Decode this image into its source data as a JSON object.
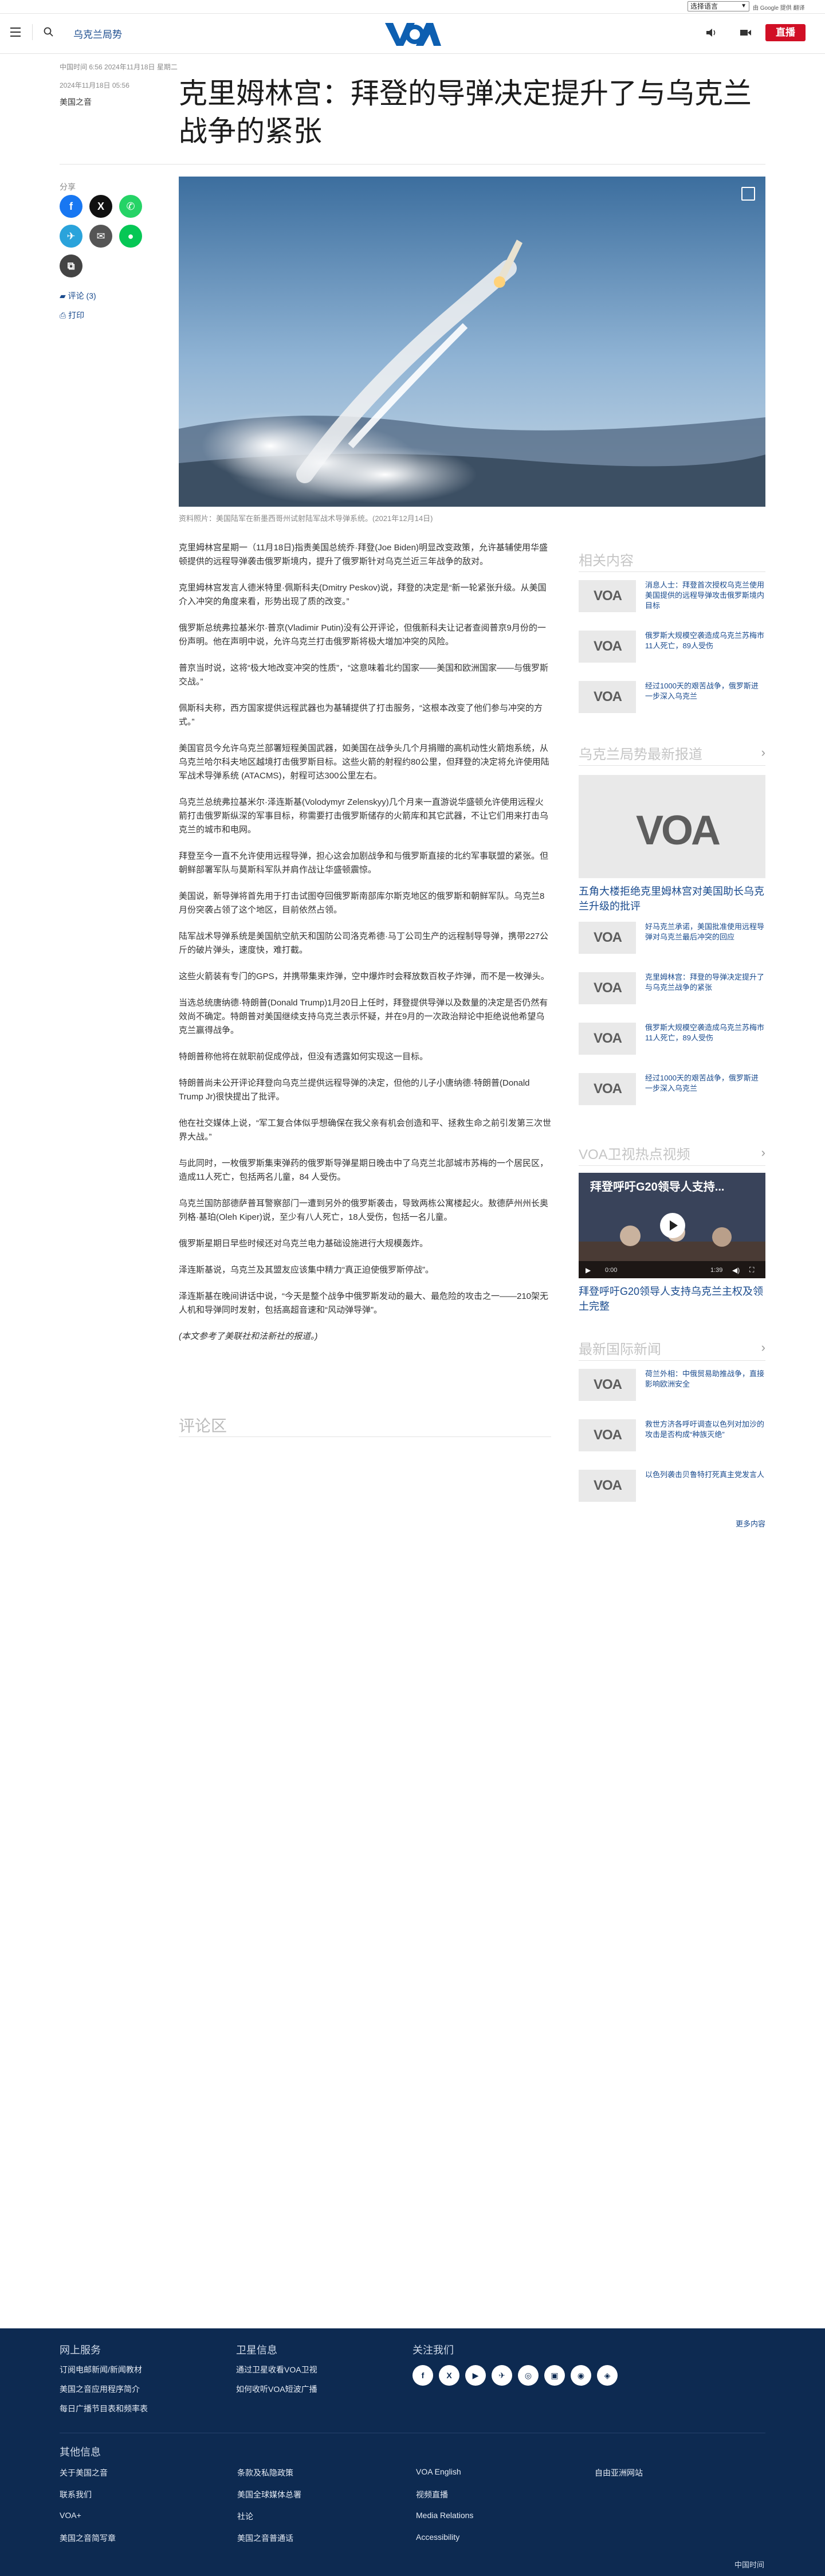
{
  "translate": {
    "select_label": "选择语言",
    "powered": "由 Google 提供 翻译"
  },
  "header": {
    "section_link": "乌克兰局势",
    "logo": "VOA",
    "live_label": "直播"
  },
  "article": {
    "meta_date": "中国时间 6:56 2024年11月18日 星期二",
    "meta_date2": "2024年11月18日 05:56",
    "author": "美国之音",
    "title": "克里姆林宫：拜登的导弹决定提升了与乌克兰战争的紧张",
    "share_label": "分享",
    "comments_link": "评论 (3)",
    "print_link": "打印",
    "caption": "资料照片：美国陆军在新墨西哥州试射陆军战术导弹系统。(2021年12月14日)",
    "paragraphs": [
      "克里姆林宫星期一（11月18日)指责美国总统乔·拜登(Joe Biden)明显改变政策，允许基辅使用华盛顿提供的远程导弹袭击俄罗斯境内，提升了俄罗斯针对乌克兰近三年战争的敌对。",
      "克里姆林宫发言人德米特里·佩斯科夫(Dmitry Peskov)说，拜登的决定是“新一轮紧张升级。从美国介入冲突的角度来看，形势出现了质的改变。”",
      "俄罗斯总统弗拉基米尔·普京(Vladimir Putin)没有公开评论，但俄新科夫让记者查阅普京9月份的一份声明。他在声明中说，允许乌克兰打击俄罗斯将极大增加冲突的风险。",
      "普京当时说，这将“极大地改变冲突的性质”，“这意味着北约国家——美国和欧洲国家——与俄罗斯交战。”",
      "佩斯科夫称，西方国家提供远程武器也为基辅提供了打击服务，“这根本改变了他们参与冲突的方式。”",
      "美国官员今允许乌克兰部署短程美国武器，如美国在战争头几个月捐赠的高机动性火箭炮系统，从乌克兰哈尔科夫地区越境打击俄罗斯目标。这些火箭的射程约80公里，但拜登的决定将允许使用陆军战术导弹系统 (ATACMS)，射程可达300公里左右。",
      "乌克兰总统弗拉基米尔·泽连斯基(Volodymyr Zelenskyy)几个月来一直游说华盛顿允许使用远程火箭打击俄罗斯纵深的军事目标，称需要打击俄罗斯储存的火箭库和其它武器，不让它们用来打击乌克兰的城市和电网。",
      "拜登至今一直不允许使用远程导弹，担心这会加剧战争和与俄罗斯直接的北约军事联盟的紧张。但朝鲜部署军队与莫斯科军队并肩作战让华盛顿震惊。",
      "美国说，新导弹将首先用于打击试图夺回俄罗斯南部库尔斯克地区的俄罗斯和朝鲜军队。乌克兰8月份突袭占领了这个地区，目前依然占领。",
      "陆军战术导弹系统是美国航空航天和国防公司洛克希德·马丁公司生产的远程制导导弹，携带227公斤的破片弹头，速度快，难打截。",
      "这些火箭装有专门的GPS，并携带集束炸弹，空中爆炸时会释放数百枚子炸弹，而不是一枚弹头。",
      "当选总统唐纳德·特朗普(Donald Trump)1月20日上任时，拜登提供导弹以及数量的决定是否仍然有效尚不确定。特朗普对美国继续支持乌克兰表示怀疑，并在9月的一次政治辩论中拒绝说他希望乌克兰赢得战争。",
      "特朗普称他将在就职前促成停战，但没有透露如何实现这一目标。",
      "特朗普尚未公开评论拜登向乌克兰提供远程导弹的决定，但他的儿子小唐纳德·特朗普(Donald Trump Jr)很快提出了批评。",
      "他在社交媒体上说，“军工复合体似乎想确保在我父亲有机会创造和平、拯救生命之前引发第三次世界大战。”",
      "与此同时，一枚俄罗斯集束弹药的俄罗斯导弹星期日晚击中了乌克兰北部城市苏梅的一个居民区，造成11人死亡，包括两名儿童，84 人受伤。",
      "乌克兰国防部德萨普耳警察部门一遭到另外的俄罗斯袭击，导致两栋公寓楼起火。敖德萨州州长奥列格·基珀(Oleh Kiper)说，至少有八人死亡，18人受伤，包括一名儿童。",
      "俄罗斯星期日早些时候还对乌克兰电力基础设施进行大规模轰炸。",
      "泽连斯基说，乌克兰及其盟友应该集中精力“真正迫使俄罗斯停战”。",
      "泽连斯基在晚间讲话中说，“今天是整个战争中俄罗斯发动的最大、最危险的攻击之一——210架无人机和导弹同时发射，包括高超音速和“风动弹导弹”。",
      "(本文参考了美联社和法新社的报道。)"
    ],
    "comments_heading": "评论区"
  },
  "sidebar": {
    "related_heading": "相关内容",
    "related": [
      "消息人士：拜登首次授权乌克兰使用美国提供的远程导弹攻击俄罗斯境内目标",
      "俄罗斯大规模空袭造成乌克兰苏梅市11人死亡，89人受伤",
      "经过1000天的艰苦战争，俄罗斯进一步深入乌克兰"
    ],
    "ukraine_heading": "乌克兰局势最新报道",
    "ukraine_feature": "五角大楼拒绝克里姆林宫对美国助长乌克兰升级的批评",
    "ukraine": [
      "好马克兰承诺，美国批准使用远程导弹对乌克兰最后冲突的回应",
      "克里姆林宫：拜登的导弹决定提升了与乌克兰战争的紧张",
      "俄罗斯大规模空袭造成乌克兰苏梅市11人死亡，89人受伤",
      "经过1000天的艰苦战争，俄罗斯进一步深入乌克兰"
    ],
    "video_heading": "VOA卫视热点视频",
    "video_title": "拜登呼吁G20领导人支持...",
    "video_time": "0:00",
    "video_duration": "1:39",
    "video_caption": "拜登呼吁G20领导人支持乌克兰主权及领土完整",
    "intl_heading": "最新国际新闻",
    "intl": [
      "荷兰外相：中俄贸易助推战争，直接影响欧洲安全",
      "救世方济各呼吁调查以色列对加沙的攻击是否构成“种族灭绝”",
      "以色列袭击贝鲁特打死真主党发言人"
    ],
    "more_link": "更多内容"
  },
  "footer": {
    "col1_head": "网上服务",
    "col1": [
      "订阅电邮新闻/新闻教材",
      "美国之音应用程序简介",
      "每日广播节目表和频率表"
    ],
    "col2_head": "卫星信息",
    "col2": [
      "通过卫星收看VOA卫视",
      "如何收听VOA短波广播"
    ],
    "col3_head": "关注我们",
    "social": [
      "f",
      "X",
      "▶",
      "✈",
      "◎",
      "▣",
      "◉",
      "◈"
    ],
    "other_head": "其他信息",
    "links": [
      [
        "关于美国之音",
        "条款及私隐政策",
        "VOA English",
        "自由亚洲网站"
      ],
      [
        "联系我们",
        "美国全球媒体总署",
        "视频直播"
      ],
      [
        "VOA+",
        "社论",
        "Media Relations"
      ],
      [
        "美国之音简写章",
        "美国之音普通话",
        "Accessibility"
      ]
    ],
    "copyright": "中国时间"
  },
  "colors": {
    "accent": "#1a4b8e",
    "live": "#d10f25",
    "footer_bg": "#0d2a51"
  }
}
